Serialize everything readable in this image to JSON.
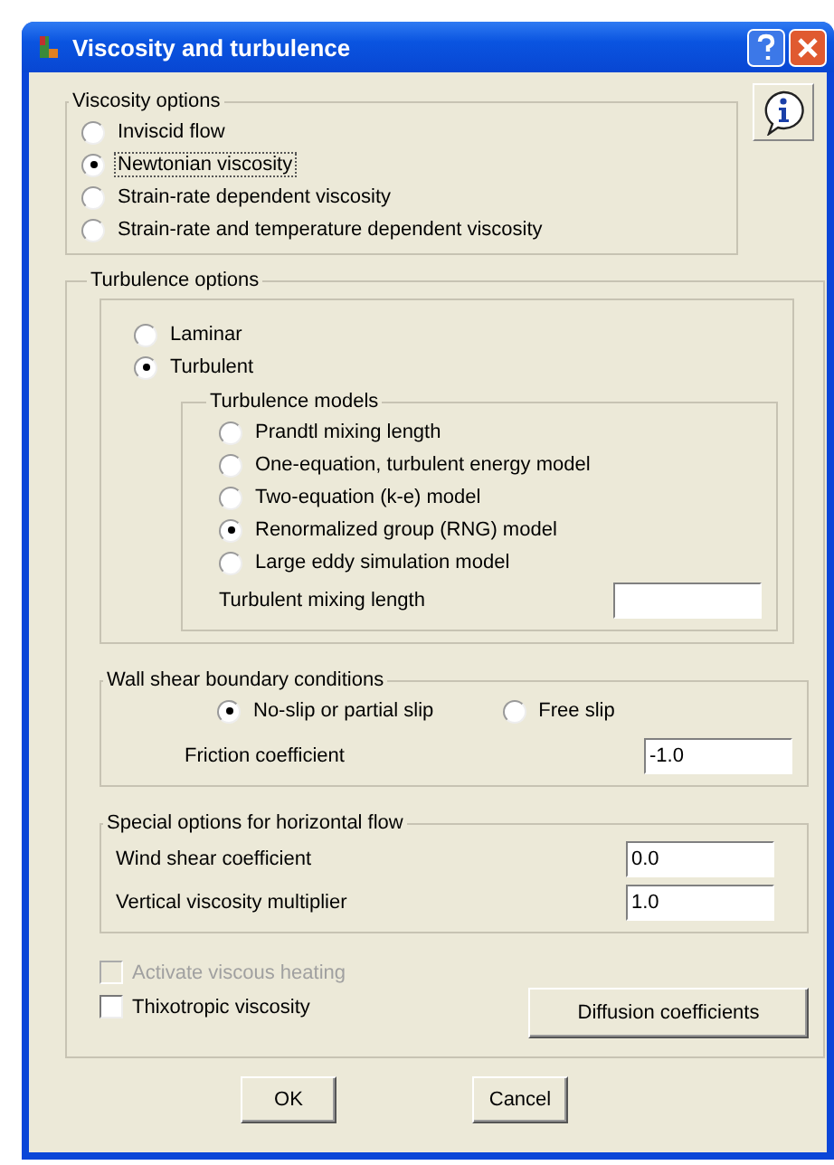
{
  "window": {
    "title": "Viscosity and turbulence"
  },
  "viscosity_options": {
    "title": "Viscosity options",
    "options": [
      {
        "label": "Inviscid flow",
        "selected": false
      },
      {
        "label": "Newtonian viscosity",
        "selected": true
      },
      {
        "label": "Strain-rate dependent viscosity",
        "selected": false
      },
      {
        "label": "Strain-rate and temperature dependent viscosity",
        "selected": false
      }
    ]
  },
  "turbulence_options": {
    "title": "Turbulence options",
    "flow_types": [
      {
        "label": "Laminar",
        "selected": false
      },
      {
        "label": "Turbulent",
        "selected": true
      }
    ],
    "turbulence_models": {
      "title": "Turbulence models",
      "options": [
        {
          "label": "Prandtl mixing length",
          "selected": false
        },
        {
          "label": "One-equation, turbulent energy model",
          "selected": false
        },
        {
          "label": "Two-equation (k-e) model",
          "selected": false
        },
        {
          "label": "Renormalized group (RNG) model",
          "selected": true
        },
        {
          "label": "Large eddy simulation model",
          "selected": false
        }
      ],
      "mixing_length": {
        "label": "Turbulent mixing length"
      }
    },
    "wall_shear": {
      "title": "Wall shear boundary conditions",
      "options": [
        {
          "label": "No-slip or partial slip",
          "selected": true
        },
        {
          "label": "Free slip",
          "selected": false
        }
      ],
      "friction": {
        "label": "Friction coefficient",
        "value": "-1.0"
      }
    },
    "horizontal_flow": {
      "title": "Special options for horizontal flow",
      "fields": [
        {
          "label": "Wind shear coefficient",
          "value": "0.0"
        },
        {
          "label": "Vertical viscosity multiplier",
          "value": "1.0"
        }
      ]
    },
    "checkboxes": [
      {
        "label": "Activate viscous heating",
        "checked": false,
        "disabled": true
      },
      {
        "label": "Thixotropic viscosity",
        "checked": false,
        "disabled": false
      }
    ],
    "diffusion_button": "Diffusion coefficients"
  },
  "buttons": [
    "OK",
    "Cancel"
  ]
}
